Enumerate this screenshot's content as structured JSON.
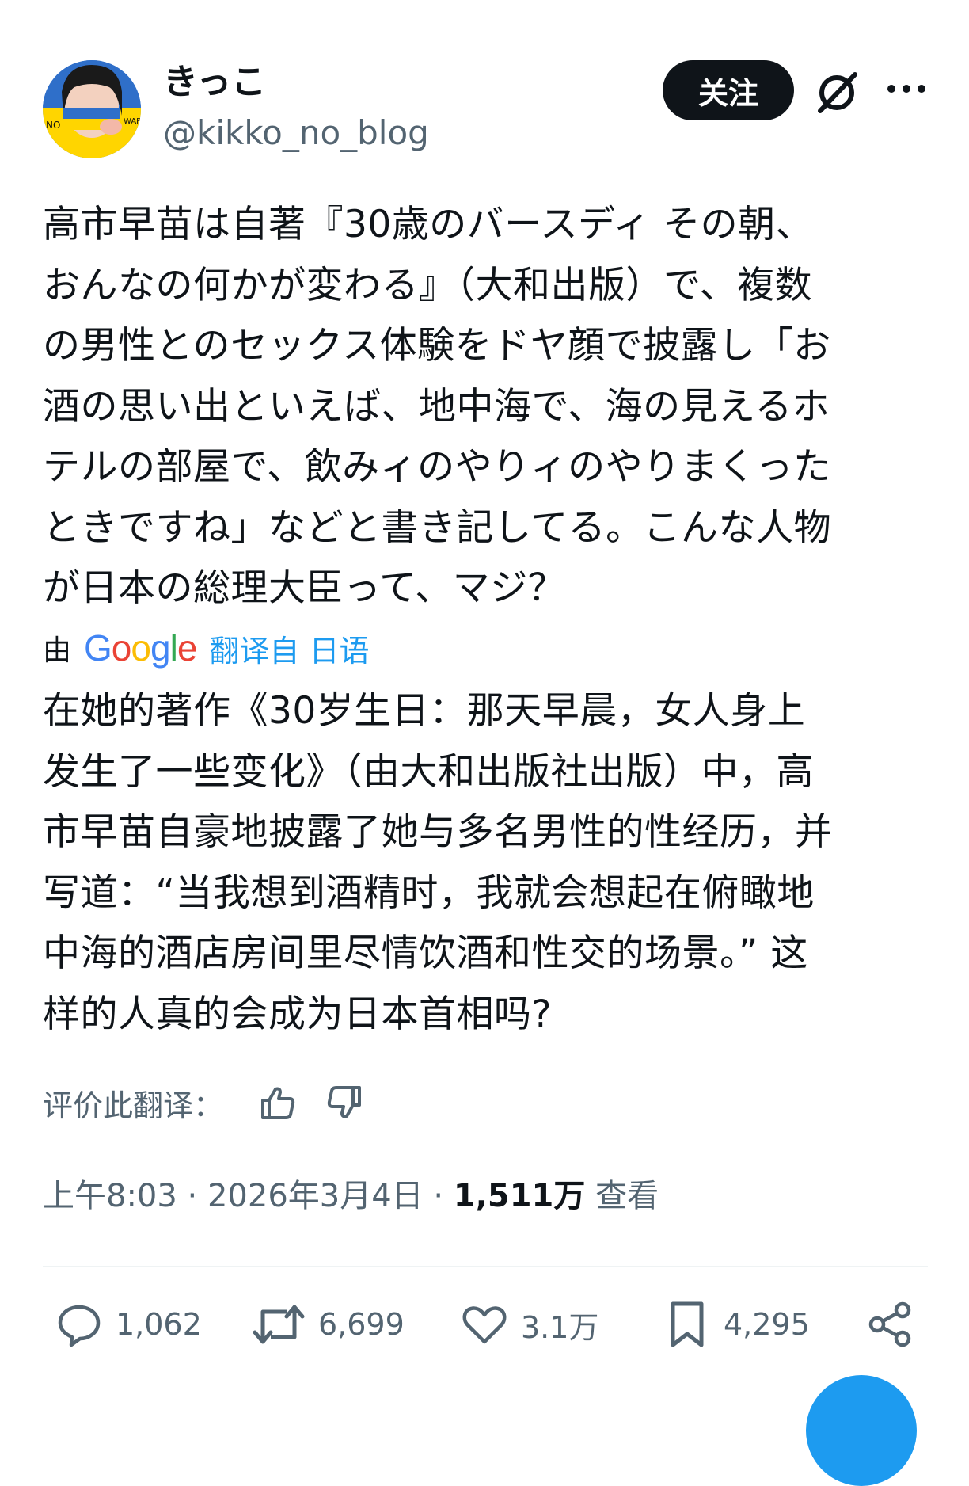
{
  "author": {
    "display_name": "きっこ",
    "handle": "@kikko_no_blog",
    "avatar_icon": "avatar-photo"
  },
  "header": {
    "follow_label": "关注",
    "grok_icon": "grok-icon",
    "more_icon": "more-horizontal-icon"
  },
  "tweet": {
    "text": "高市早苗は自著『30歳のバースディ その朝、\nおんなの何かが変わる』（大和出版）で、複数\nの男性とのセックス体験をドヤ顔で披露し「お\n酒の思い出といえば、地中海で、海の見えるホ\nテルの部屋で、飲みィのやりィのやりまくった\nときですね」などと書き記してる。こんな人物\nが日本の総理大臣って、マジ？"
  },
  "translation": {
    "by_label": "由",
    "provider": "Google",
    "link_text": "翻译自 日语",
    "text": "在她的著作《30岁生日：那天早晨，女人身上\n发生了一些变化》（由大和出版社出版）中，高\n市早苗自豪地披露了她与多名男性的性经历，并\n写道：“当我想到酒精时，我就会想起在俯瞰地\n中海的酒店房间里尽情饮酒和性交的场景。” 这\n样的人真的会成为日本首相吗?",
    "rate_label": "评价此翻译："
  },
  "meta": {
    "time": "上午8:03",
    "separator": " · ",
    "date": "2026年3月4日",
    "views_count": "1,511万",
    "views_label": " 查看"
  },
  "actions": {
    "replies": "1,062",
    "reposts": "6,699",
    "likes": "3.1万",
    "bookmarks": "4,295"
  },
  "colors": {
    "accent": "#1d9bf0",
    "text_primary": "#0f1419",
    "text_secondary": "#536471",
    "divider": "#eff3f4",
    "google_blue": "#4285F4",
    "google_red": "#EA4335",
    "google_yellow": "#FBBC05",
    "google_green": "#34A853"
  }
}
